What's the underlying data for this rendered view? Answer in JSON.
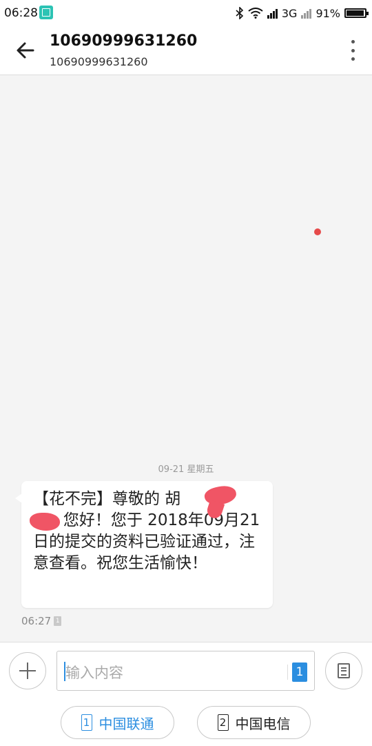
{
  "status_bar": {
    "time": "06:28",
    "network": "3G",
    "battery": "91%",
    "battery_level": 0.91,
    "icons": [
      "screenshot-app-icon",
      "bluetooth-icon",
      "wifi-icon",
      "signal-icon",
      "signal-icon",
      "battery-icon"
    ]
  },
  "header": {
    "title": "10690999631260",
    "subtitle": "10690999631260",
    "back_icon": "arrow-left-icon",
    "menu_icon": "more-vertical-icon"
  },
  "conversation": {
    "date_label": "09-21  星期五",
    "messages": [
      {
        "text": "【花不完】尊敬的 胡\n      您好！您于 2018年09月21日的提交的资料已验证通过，注意查看。祝您生活愉快！",
        "time": "06:27",
        "sim": "1"
      }
    ]
  },
  "composer": {
    "placeholder": "输入内容",
    "sim_badge": "1",
    "plus_icon": "plus-icon",
    "template_icon": "document-icon"
  },
  "sim_buttons": [
    {
      "num": "1",
      "label": "中国联通",
      "color": "#2b8ee0"
    },
    {
      "num": "2",
      "label": "中国电信",
      "color": "#222222"
    }
  ],
  "colors": {
    "accent": "#2b8ee0",
    "redaction": "#f05565",
    "unread_dot": "#e64a4a",
    "app_icon": "#2cc3b4"
  }
}
